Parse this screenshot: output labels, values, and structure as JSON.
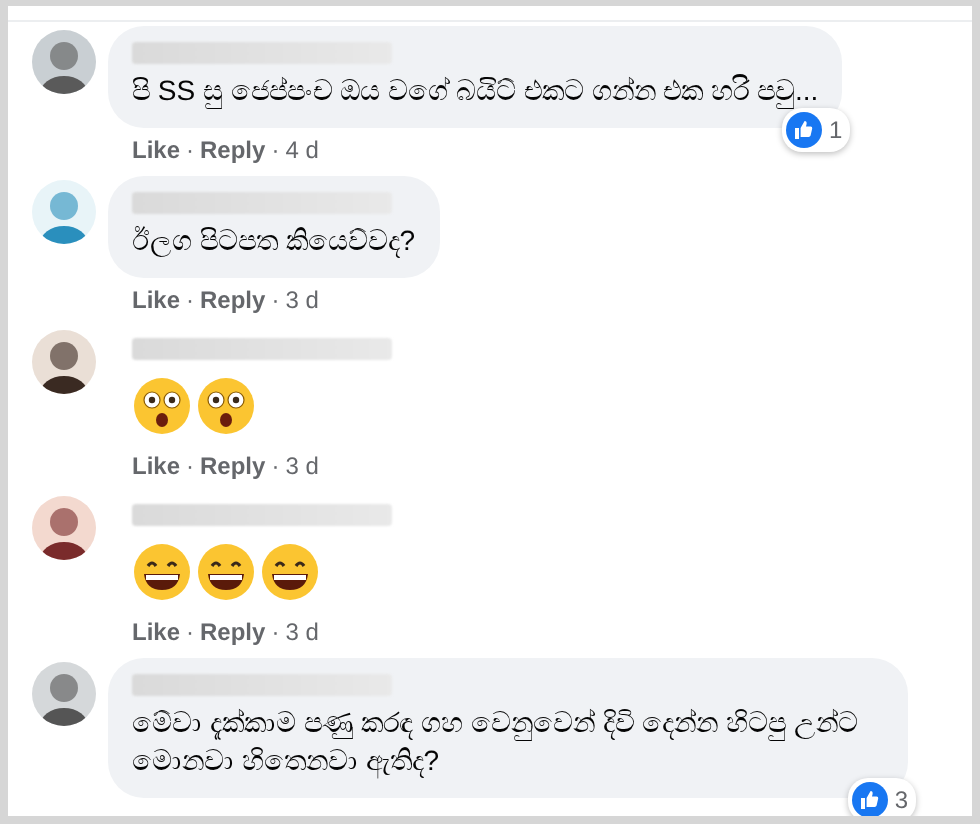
{
  "comments": [
    {
      "kind": "text",
      "text": "පි SS සු ජෙප්පංච ඔය වගේ බයිට් එකට ගන්න එක හරි පවු...",
      "reactions": {
        "count": "1"
      },
      "actions": {
        "like": "Like",
        "separator_1": "·",
        "reply": "Reply",
        "separator_2": "·",
        "time": "4 d"
      }
    },
    {
      "kind": "text",
      "text": "ඊලග පිටපත කියෙව්වද?",
      "actions": {
        "like": "Like",
        "separator_1": "·",
        "reply": "Reply",
        "separator_2": "·",
        "time": "3 d"
      }
    },
    {
      "kind": "emoji",
      "emojis": [
        {
          "kind": "astonished"
        },
        {
          "kind": "astonished"
        }
      ],
      "actions": {
        "like": "Like",
        "separator_1": "·",
        "reply": "Reply",
        "separator_2": "·",
        "time": "3 d"
      }
    },
    {
      "kind": "emoji",
      "emojis": [
        {
          "kind": "grinning"
        },
        {
          "kind": "grinning"
        },
        {
          "kind": "grinning"
        }
      ],
      "actions": {
        "like": "Like",
        "separator_1": "·",
        "reply": "Reply",
        "separator_2": "·",
        "time": "3 d"
      }
    },
    {
      "kind": "text",
      "text": "මේවා දැක්කාම පණු කරඳ ගහ වෙනුවෙන් දිවි දෙන්න හිටපු උන්ට මොනවා හිතෙනවා ඇතිද?",
      "reactions": {
        "count": "3"
      }
    }
  ]
}
